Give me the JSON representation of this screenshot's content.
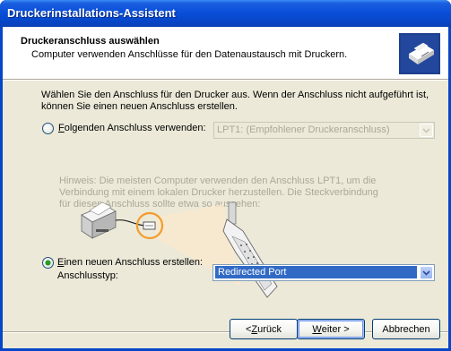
{
  "window": {
    "title": "Druckerinstallations-Assistent"
  },
  "header": {
    "title": "Druckeranschluss auswählen",
    "subtitle": "Computer verwenden Anschlüsse für den Datenaustausch mit Druckern.",
    "icon": "printer-icon"
  },
  "intro": "Wählen Sie den Anschluss für den Drucker aus. Wenn der Anschluss nicht aufgeführt ist, können Sie einen neuen Anschluss erstellen.",
  "option_existing": {
    "label_prefix": "",
    "label_hotkey": "F",
    "label_rest": "olgenden Anschluss verwenden:",
    "selected": false,
    "select_value": "LPT1: (Empfohlener Druckeranschluss)",
    "enabled": false
  },
  "hint": "Hinweis: Die meisten Computer verwenden den Anschluss LPT1, um die Verbindung mit einem lokalen Drucker herzustellen. Die Steckverbindung für diesen Anschluss sollte etwa so aussehen:",
  "option_new": {
    "label_hotkey": "E",
    "label_rest": "inen neuen Anschluss erstellen:",
    "selected": true,
    "type_label": "Anschlusstyp:",
    "select_value": "Redirected Port"
  },
  "buttons": {
    "back_prefix": "< ",
    "back_hotkey": "Z",
    "back_rest": "urück",
    "next_hotkey": "W",
    "next_rest": "eiter >",
    "cancel": "Abbrechen"
  },
  "colors": {
    "titlebar": "#0a4fd8",
    "face": "#ece9d8",
    "highlight_ring": "#f39b2c",
    "selection": "#316ac5"
  }
}
